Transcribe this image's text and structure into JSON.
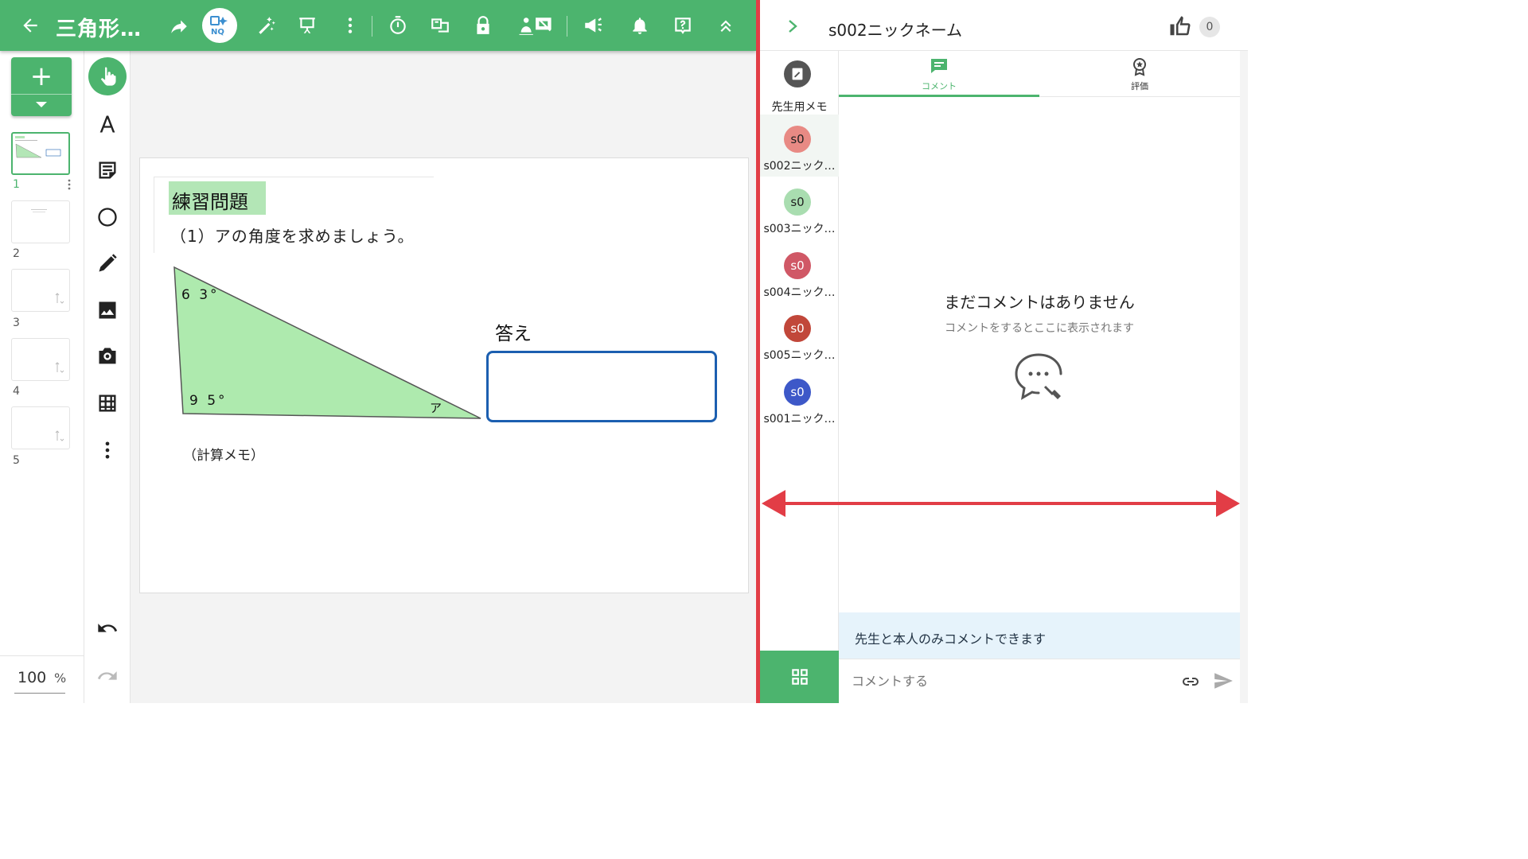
{
  "toolbar": {
    "title": "三角形…",
    "accent": "#4cb46e",
    "icons": [
      "back-icon",
      "share-icon",
      "nq-icon",
      "magic-icon",
      "present-icon",
      "more-vert-icon",
      "timer-icon",
      "translate-icon",
      "lock-icon",
      "hide-screen-icon",
      "megaphone-icon",
      "bell-icon",
      "help-icon",
      "collapse-icon"
    ]
  },
  "pages": {
    "numbers": [
      "1",
      "2",
      "3",
      "4",
      "5"
    ],
    "active": "1"
  },
  "zoom": {
    "value": "100",
    "unit": "%"
  },
  "slide": {
    "heading": "練習問題",
    "question": "（1）アの角度を求めましょう。",
    "angle_top": "6 3°",
    "angle_bottom": "9 5°",
    "angle_unknown": "ア",
    "answer_label": "答え",
    "memo_label": "（計算メモ）"
  },
  "panel": {
    "student_name": "s002ニックネーム",
    "like_count": "0",
    "teacher_memo_label": "先生用メモ",
    "students": [
      {
        "avatar": "s0",
        "name": "s002ニック…",
        "color": "#e88a84"
      },
      {
        "avatar": "s0",
        "name": "s003ニック…",
        "color": "#a9ddb0"
      },
      {
        "avatar": "s0",
        "name": "s004ニック…",
        "color": "#d05866"
      },
      {
        "avatar": "s0",
        "name": "s005ニック…",
        "color": "#c1473a"
      },
      {
        "avatar": "s0",
        "name": "s001ニック…",
        "color": "#3d58c8"
      }
    ],
    "tabs": [
      "コメント",
      "評価"
    ],
    "empty_title": "まだコメントはありません",
    "empty_sub": "コメントをするとここに表示されます",
    "notice": "先生と本人のみコメントできます",
    "comment_placeholder": "コメントする"
  }
}
